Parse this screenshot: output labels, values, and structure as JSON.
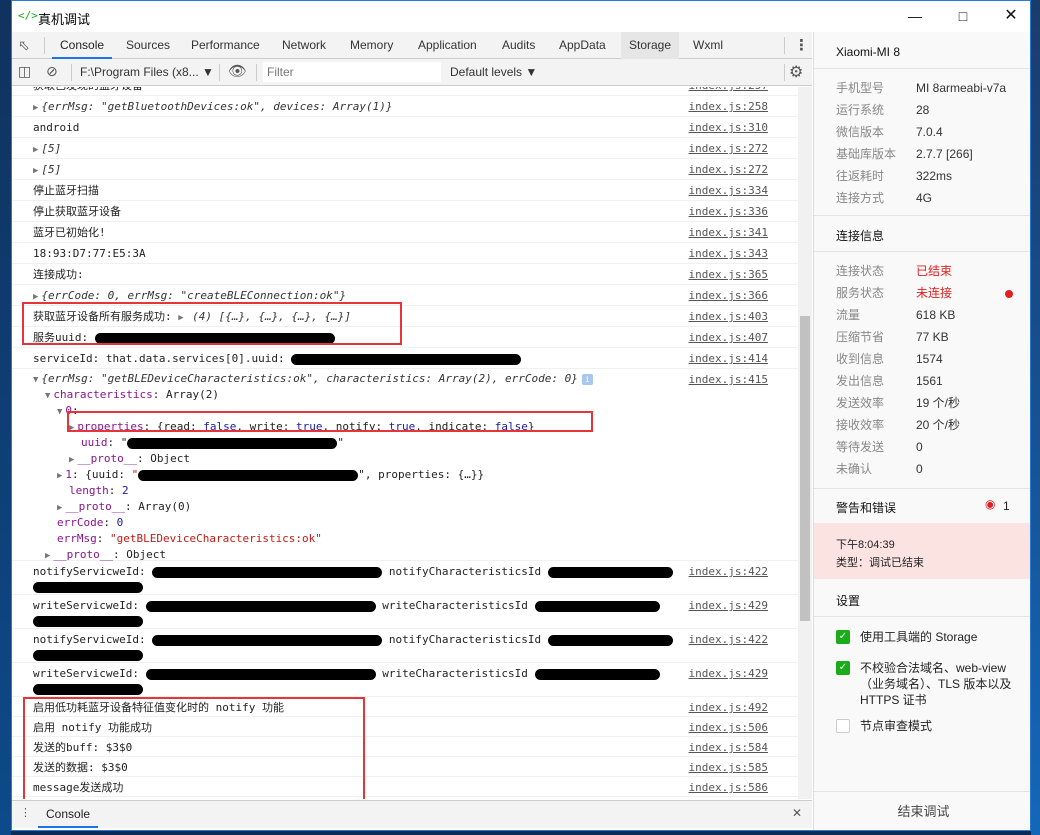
{
  "window": {
    "title": "真机调试",
    "icon": "code-icon",
    "controls": [
      "minimize-icon",
      "maximize-icon",
      "close-icon"
    ]
  },
  "tabs": [
    "Console",
    "Sources",
    "Performance",
    "Network",
    "Memory",
    "Application",
    "Audits",
    "AppData",
    "Storage",
    "Wxml"
  ],
  "active_tab": "Console",
  "toolbar": {
    "context": "F:\\Program Files (x8...",
    "filter_placeholder": "Filter",
    "levels": "Default levels ▼"
  },
  "console": {
    "rows": [
      {
        "parts": [
          [
            "获取已发现的蓝牙设备",
            ""
          ]
        ],
        "src": "index.js:257"
      },
      {
        "tri": true,
        "parts": [
          [
            "{errMsg: ",
            "it"
          ],
          [
            "\"getBluetoothDevices:ok\"",
            "str it"
          ],
          [
            ", devices: Array(1)}",
            "it"
          ]
        ],
        "src": "index.js:258"
      },
      {
        "parts": [
          [
            "android",
            ""
          ]
        ],
        "src": "index.js:310"
      },
      {
        "tri": true,
        "parts": [
          [
            "[5]",
            "it"
          ]
        ],
        "src": "index.js:272"
      },
      {
        "tri": true,
        "parts": [
          [
            "[5]",
            "it"
          ]
        ],
        "src": "index.js:272"
      },
      {
        "parts": [
          [
            "停止蓝牙扫描",
            ""
          ]
        ],
        "src": "index.js:334"
      },
      {
        "parts": [
          [
            "停止获取蓝牙设备",
            ""
          ]
        ],
        "src": "index.js:336"
      },
      {
        "parts": [
          [
            "蓝牙已初始化!",
            ""
          ]
        ],
        "src": "index.js:341"
      },
      {
        "parts": [
          [
            "18:93:D7:77:E5:3A",
            ""
          ]
        ],
        "src": "index.js:343"
      },
      {
        "parts": [
          [
            "连接成功:",
            ""
          ]
        ],
        "src": "index.js:365"
      },
      {
        "tri": true,
        "parts": [
          [
            "{errCode: ",
            "it"
          ],
          [
            "0",
            "kw it"
          ],
          [
            ", errMsg: ",
            "it"
          ],
          [
            "\"createBLEConnection:ok\"",
            "str it"
          ],
          [
            "}",
            "it"
          ]
        ],
        "src": "index.js:366"
      },
      {
        "parts": [
          [
            "获取蓝牙设备所有服务成功:  ",
            ""
          ],
          [
            "▶ ",
            "tri"
          ],
          [
            "(4) [{…}, {…}, {…}, {…}]",
            "it"
          ]
        ],
        "src": "index.js:403"
      },
      {
        "parts": [
          [
            "服务uuid: ",
            ""
          ]
        ],
        "redact": 240,
        "src": "index.js:407"
      },
      {
        "parts": [
          [
            "serviceId: that.data.services[0].uuid:  ",
            ""
          ]
        ],
        "redact": 230,
        "src": "index.js:414"
      }
    ],
    "expanded": {
      "src": "index.js:415",
      "lines": [
        {
          "ind": 0,
          "tri": "▼",
          "parts": [
            [
              "{errMsg: ",
              "it"
            ],
            [
              "\"getBLEDeviceCharacteristics:ok\"",
              "str it"
            ],
            [
              ", characteristics: Array(2), errCode: ",
              "it"
            ],
            [
              "0",
              "kw it"
            ],
            [
              "}",
              "it"
            ]
          ],
          "info": "i"
        },
        {
          "ind": 1,
          "tri": "▼",
          "parts": [
            [
              "characteristics",
              "prop"
            ],
            [
              ": Array(2)",
              ""
            ]
          ]
        },
        {
          "ind": 2,
          "tri": "▼",
          "parts": [
            [
              "0",
              "prop"
            ],
            [
              ":",
              ""
            ]
          ]
        },
        {
          "ind": 3,
          "tri": "▶",
          "parts": [
            [
              "properties",
              "prop"
            ],
            [
              ": {read: ",
              ""
            ],
            [
              "false",
              "kw"
            ],
            [
              ", write: ",
              ""
            ],
            [
              "true",
              "kw"
            ],
            [
              ", notify: ",
              ""
            ],
            [
              "true",
              "kw"
            ],
            [
              ", indicate: ",
              ""
            ],
            [
              "false",
              "kw"
            ],
            [
              "}",
              ""
            ]
          ]
        },
        {
          "ind": 3,
          "parts": [
            [
              "uuid",
              "prop"
            ],
            [
              ": \"",
              ""
            ]
          ],
          "redact": 210,
          "after": "\""
        },
        {
          "ind": 3,
          "tri": "▶",
          "parts": [
            [
              "__proto__",
              "prop"
            ],
            [
              ": Object",
              ""
            ]
          ]
        },
        {
          "ind": 2,
          "tri": "▶",
          "parts": [
            [
              "1",
              "prop"
            ],
            [
              ": {uuid: ",
              ""
            ],
            [
              "\"",
              "str"
            ]
          ],
          "redact": 220,
          "after": "\", properties: {…}}"
        },
        {
          "ind": 2,
          "parts": [
            [
              "length",
              "prop"
            ],
            [
              ": ",
              ""
            ],
            [
              "2",
              "kw"
            ]
          ]
        },
        {
          "ind": 2,
          "tri": "▶",
          "parts": [
            [
              "__proto__",
              "prop"
            ],
            [
              ": Array(0)",
              ""
            ]
          ]
        },
        {
          "ind": 1,
          "parts": [
            [
              "errCode",
              "prop"
            ],
            [
              ": ",
              ""
            ],
            [
              "0",
              "kw"
            ]
          ]
        },
        {
          "ind": 1,
          "parts": [
            [
              "errMsg",
              "prop"
            ],
            [
              ": ",
              ""
            ],
            [
              "\"getBLEDeviceCharacteristics:ok\"",
              "str"
            ]
          ]
        },
        {
          "ind": 1,
          "tri": "▶",
          "parts": [
            [
              "__proto__",
              "prop"
            ],
            [
              ": Object",
              ""
            ]
          ]
        }
      ]
    },
    "id_rows": [
      {
        "a": "notifyServicweId: ",
        "b": " notifyCharacteristicsId ",
        "src": "index.js:422"
      },
      {
        "a": "writeServicweId: ",
        "b": " writeCharacteristicsId ",
        "src": "index.js:429"
      },
      {
        "a": "notifyServicweId: ",
        "b": " notifyCharacteristicsId ",
        "src": "index.js:422"
      },
      {
        "a": "writeServicweId: ",
        "b": " writeCharacteristicsId ",
        "src": "index.js:429"
      }
    ],
    "tail_rows": [
      {
        "text": "启用低功耗蓝牙设备特征值变化时的 notify 功能",
        "src": "index.js:492"
      },
      {
        "text": "启用 notify 功能成功",
        "src": "index.js:506"
      },
      {
        "text": "发送的buff: $3$0",
        "src": "index.js:584"
      },
      {
        "text": "发送的数据: $3$0",
        "src": "index.js:585"
      },
      {
        "text": "message发送成功",
        "src": "index.js:586"
      }
    ]
  },
  "drawer": {
    "tab": "Console"
  },
  "panel": {
    "device": "Xiaomi-MI 8",
    "device_info": [
      [
        "手机型号",
        "MI 8armeabi-v7a"
      ],
      [
        "运行系统",
        "28"
      ],
      [
        "微信版本",
        "7.0.4"
      ],
      [
        "基础库版本",
        "2.7.7 [266]"
      ],
      [
        "往返耗时",
        "322ms"
      ],
      [
        "连接方式",
        "4G"
      ]
    ],
    "conn_title": "连接信息",
    "conn_info": [
      [
        "连接状态",
        "已结束"
      ],
      [
        "服务状态",
        "未连接"
      ],
      [
        "流量",
        "618 KB"
      ],
      [
        "压缩节省",
        "77 KB"
      ],
      [
        "收到信息",
        "1574"
      ],
      [
        "发出信息",
        "1561"
      ],
      [
        "发送效率",
        "19 个/秒"
      ],
      [
        "接收效率",
        "20 个/秒"
      ],
      [
        "等待发送",
        "0"
      ],
      [
        "未确认",
        "0"
      ]
    ],
    "status_color": "#e02020",
    "warn_title": "警告和错误",
    "warn_count": "1",
    "error": {
      "time": "下午8:04:39",
      "type": "类型：调试已结束"
    },
    "settings_title": "设置",
    "settings": [
      {
        "label": "使用工具端的 Storage",
        "checked": true
      },
      {
        "label": "不校验合法域名、web-view（业务域名）、TLS 版本以及 HTTPS 证书",
        "checked": true
      },
      {
        "label": "节点审查模式",
        "checked": false
      }
    ],
    "end_button": "结束调试"
  }
}
